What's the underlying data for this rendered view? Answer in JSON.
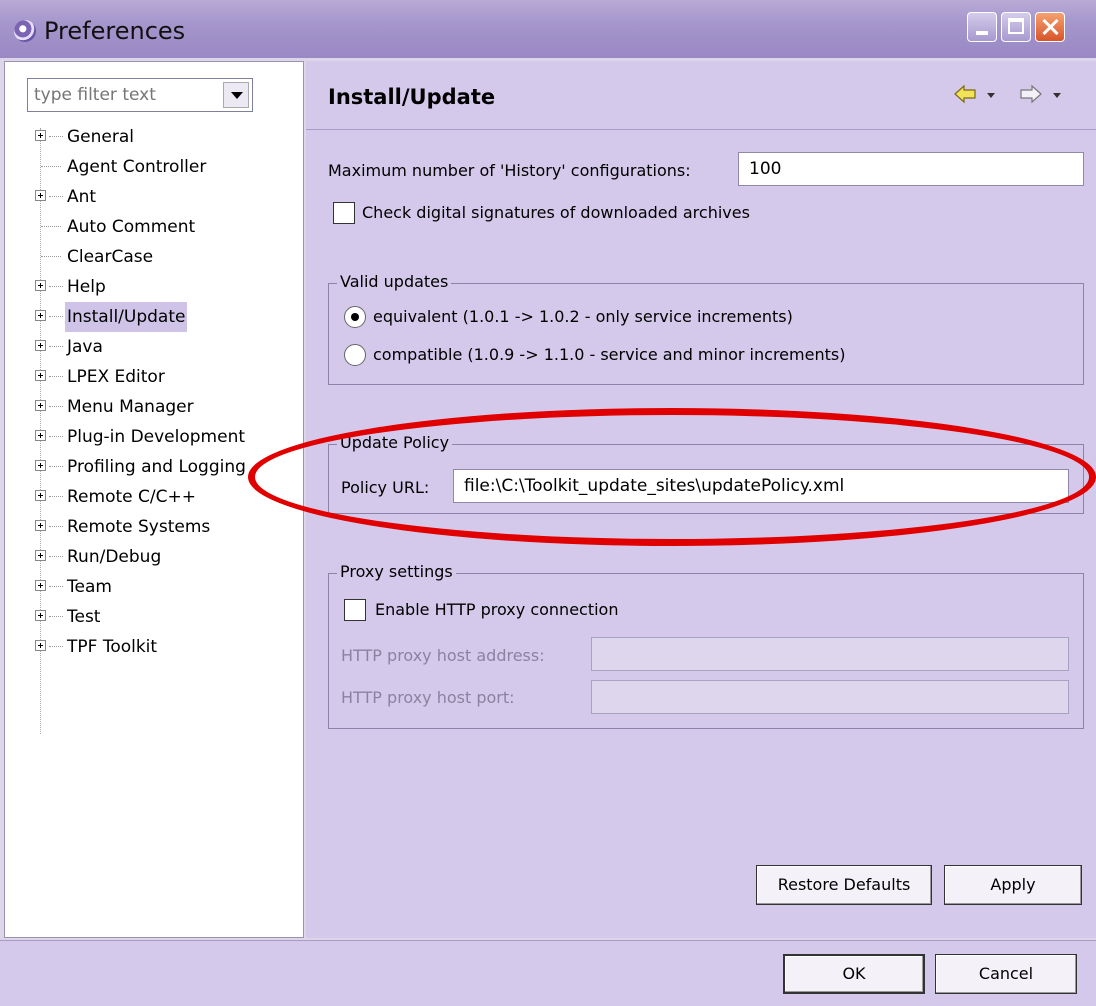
{
  "window": {
    "title": "Preferences"
  },
  "filter": {
    "placeholder": "type filter text"
  },
  "tree": {
    "items": [
      {
        "label": "General",
        "expandable": true
      },
      {
        "label": "Agent Controller",
        "expandable": false
      },
      {
        "label": "Ant",
        "expandable": true
      },
      {
        "label": "Auto Comment",
        "expandable": false
      },
      {
        "label": "ClearCase",
        "expandable": false
      },
      {
        "label": "Help",
        "expandable": true
      },
      {
        "label": "Install/Update",
        "expandable": true,
        "selected": true
      },
      {
        "label": "Java",
        "expandable": true
      },
      {
        "label": "LPEX Editor",
        "expandable": true
      },
      {
        "label": "Menu Manager",
        "expandable": true
      },
      {
        "label": "Plug-in Development",
        "expandable": true
      },
      {
        "label": "Profiling and Logging",
        "expandable": true
      },
      {
        "label": "Remote C/C++",
        "expandable": true
      },
      {
        "label": "Remote Systems",
        "expandable": true
      },
      {
        "label": "Run/Debug",
        "expandable": true
      },
      {
        "label": "Team",
        "expandable": true
      },
      {
        "label": "Test",
        "expandable": true
      },
      {
        "label": "TPF Toolkit",
        "expandable": true
      }
    ]
  },
  "page": {
    "title": "Install/Update",
    "history_label": "Maximum number of 'History' configurations:",
    "history_value": "100",
    "check_signatures_label": "Check digital signatures of downloaded archives",
    "check_signatures_checked": false,
    "valid_updates": {
      "title": "Valid updates",
      "option_equivalent": "equivalent (1.0.1 -> 1.0.2 - only service increments)",
      "option_compatible": "compatible (1.0.9 -> 1.1.0 - service and minor increments)",
      "selected": "equivalent"
    },
    "update_policy": {
      "title": "Update Policy",
      "url_label": "Policy URL:",
      "url_value": "file:\\C:\\Toolkit_update_sites\\updatePolicy.xml"
    },
    "proxy": {
      "title": "Proxy settings",
      "enable_label": "Enable HTTP proxy connection",
      "enable_checked": false,
      "host_label": "HTTP proxy host address:",
      "host_value": "",
      "port_label": "HTTP proxy host port:",
      "port_value": ""
    },
    "restore_defaults_label": "Restore Defaults",
    "apply_label": "Apply"
  },
  "dialog": {
    "ok_label": "OK",
    "cancel_label": "Cancel"
  },
  "icons": {
    "app": "preferences-icon",
    "back": "back-arrow-icon",
    "forward": "forward-arrow-icon"
  },
  "colors": {
    "titlebar": "#a596cc",
    "panel": "#d4c9ea",
    "selection": "#cfc4e8",
    "back_arrow": "#f2e25a",
    "annotation": "#e00000"
  }
}
